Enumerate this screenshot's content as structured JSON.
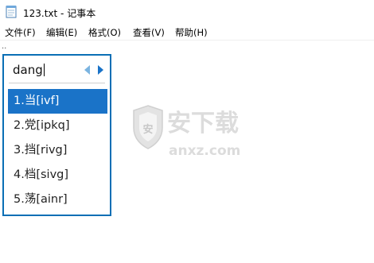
{
  "window": {
    "title": "123.txt - 记事本"
  },
  "menubar": {
    "items": [
      {
        "label": "文件(F)"
      },
      {
        "label": "编辑(E)"
      },
      {
        "label": "格式(O)"
      },
      {
        "label": "查看(V)"
      },
      {
        "label": "帮助(H)"
      }
    ]
  },
  "ime": {
    "composition": "dang",
    "candidates": [
      {
        "text": "1.当[ivf]",
        "selected": true
      },
      {
        "text": "2.党[ipkq]",
        "selected": false
      },
      {
        "text": "3.挡[rivg]",
        "selected": false
      },
      {
        "text": "4.档[sivg]",
        "selected": false
      },
      {
        "text": "5.荡[ainr]",
        "selected": false
      }
    ]
  },
  "watermark": {
    "cn": "安下载",
    "en": "anxz.com"
  },
  "colors": {
    "accent": "#1a73c8",
    "border": "#0a6fb5",
    "watermark": "#d9d9d9"
  }
}
